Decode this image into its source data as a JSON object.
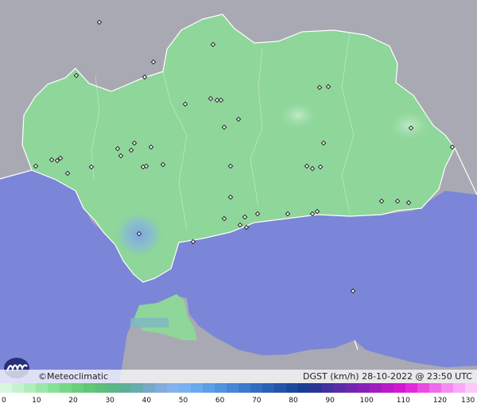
{
  "footer": {
    "brand": "©Meteoclimatic",
    "caption": "DGST (km/h)  28-10-2022 @ 23:50 UTC"
  },
  "scale": {
    "ticks": [
      "0",
      "10",
      "20",
      "30",
      "40",
      "50",
      "60",
      "70",
      "80",
      "90",
      "100",
      "110",
      "120",
      "130"
    ],
    "colors": [
      "#d8f7df",
      "#c6f2cf",
      "#b1edbd",
      "#9be7aa",
      "#86e097",
      "#76d886",
      "#69cf7a",
      "#62c676",
      "#5dbd7c",
      "#5bb68a",
      "#5eaf9a",
      "#69abb0",
      "#77a9c6",
      "#83abdb",
      "#85b2ec",
      "#79b1f0",
      "#6aa9ee",
      "#5c9ee8",
      "#4f92e0",
      "#4586d6",
      "#3b79cc",
      "#326cc1",
      "#2a60b6",
      "#2354aa",
      "#1e489e",
      "#1a3d92",
      "#2b3496",
      "#44309e",
      "#5a2ca6",
      "#7026af",
      "#8820b8",
      "#a11bc1",
      "#ba18ca",
      "#d218d2",
      "#e229db",
      "#e94ae2",
      "#ef6be9",
      "#f48cef",
      "#f8aaf4",
      "#fbc8f8"
    ]
  },
  "map": {
    "colors": {
      "sea": "#7b86d8",
      "land_outside": "#a9a9b3",
      "land_region": "#8ed69a",
      "border": "#ffffff",
      "gust_high": "#7fa0e6",
      "station_marker": "#222222"
    },
    "features": [
      "sea",
      "andalusia-region",
      "province-borders",
      "weather-stations",
      "gust-hotspot-cadiz"
    ]
  }
}
